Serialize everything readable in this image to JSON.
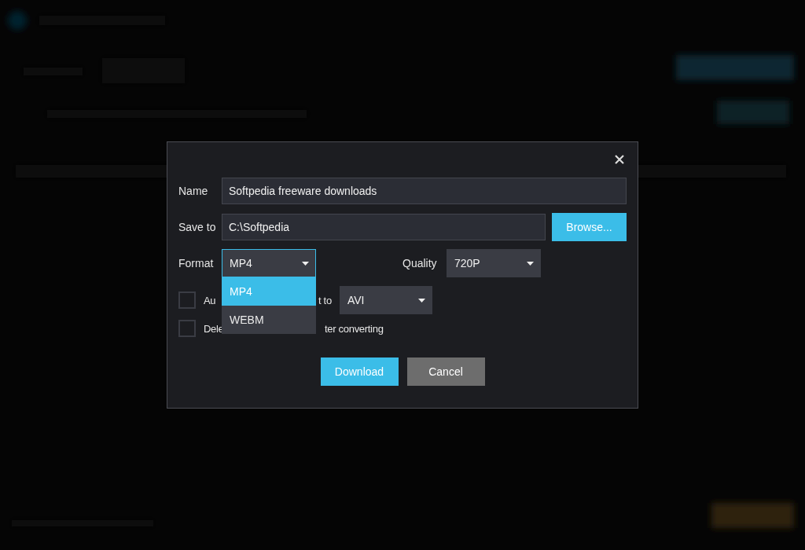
{
  "dialog": {
    "fields": [
      {
        "label": "Name",
        "value": "Softpedia freeware downloads"
      },
      {
        "label": "Save to",
        "value": "C:\\Softpedia",
        "button": "Browse..."
      }
    ],
    "format": {
      "label": "Format",
      "value": "MP4",
      "open": true,
      "options": [
        {
          "label": "MP4",
          "selected": true
        },
        {
          "label": "WEBM",
          "selected": false
        }
      ]
    },
    "quality": {
      "label": "Quality",
      "value": "720P"
    },
    "checks": [
      {
        "label_start": "Au",
        "label_end": "t to",
        "checked": false,
        "select": "AVI"
      },
      {
        "label_start": "Dele",
        "label_end": "ter converting",
        "checked": false
      }
    ],
    "buttons": [
      {
        "label": "Download",
        "kind": "primary"
      },
      {
        "label": "Cancel",
        "kind": "secondary"
      }
    ]
  }
}
